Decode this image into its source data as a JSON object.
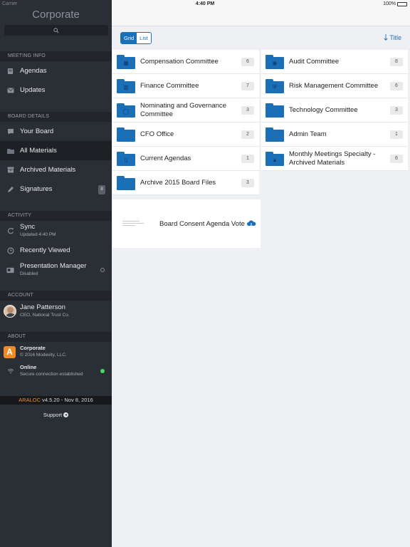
{
  "status_bar": {
    "carrier": "Carrier",
    "time": "4:40 PM",
    "battery": "100%"
  },
  "sidebar": {
    "title": "Corporate",
    "sections": {
      "meeting_info": "MEETING INFO",
      "board_details": "BOARD DETAILS",
      "activity": "ACTIVITY",
      "account": "ACCOUNT",
      "about": "ABOUT"
    },
    "meeting_items": [
      {
        "label": "Agendas",
        "icon": "agenda-icon"
      },
      {
        "label": "Updates",
        "icon": "mail-icon"
      }
    ],
    "board_items": [
      {
        "label": "Your Board",
        "icon": "chat-icon"
      },
      {
        "label": "All Materials",
        "icon": "folder-icon",
        "active": true
      },
      {
        "label": "Archived Materials",
        "icon": "archive-icon"
      },
      {
        "label": "Signatures",
        "icon": "pen-icon",
        "badge": "8"
      }
    ],
    "activity_items": [
      {
        "label": "Sync",
        "sub": "Updated 4:40 PM",
        "icon": "sync-icon"
      },
      {
        "label": "Recently Viewed",
        "icon": "clock-icon"
      },
      {
        "label": "Presentation Manager",
        "sub": "Disabled",
        "icon": "presentation-icon"
      }
    ],
    "account": {
      "name": "Jane Patterson",
      "role": "CEO, National Trust Co."
    },
    "about": [
      {
        "label": "Corporate",
        "sub": "© 2016 Modevity, LLC.",
        "icon": "app-logo-icon"
      },
      {
        "label": "Online",
        "sub": "Secure connection established",
        "icon": "wifi-icon"
      }
    ],
    "version": {
      "brand": "ARALOC",
      "text": " v4.5.20 - Nov 8, 2016"
    },
    "support": "Support"
  },
  "main": {
    "view_toggle": {
      "grid": "Grid",
      "list": "List",
      "selected": "Grid"
    },
    "sort_label": "Title",
    "folders_left": [
      {
        "name": "Compensation Committee",
        "count": "6"
      },
      {
        "name": "Finance Committee",
        "count": "7"
      },
      {
        "name": "Nominating and Governance Committee",
        "count": "3"
      },
      {
        "name": "CFO Office",
        "count": "2"
      },
      {
        "name": "Current Agendas",
        "count": "1"
      },
      {
        "name": "Archive 2015 Board Files",
        "count": "3"
      }
    ],
    "folders_right": [
      {
        "name": "Audit Committee",
        "count": "8"
      },
      {
        "name": "Risk Management Committee",
        "count": "6"
      },
      {
        "name": "Technology Committee",
        "count": "3"
      },
      {
        "name": "Admin Team",
        "count": "1"
      },
      {
        "name": "Monthly Meetings Specialty - Archived Materials",
        "count": "6"
      }
    ],
    "document": {
      "name": "Board Consent Agenda Vote",
      "icon": "cloud-download-icon"
    }
  },
  "colors": {
    "accent": "#1b6fb6",
    "sidebar_bg": "#2a2e35",
    "brand": "#f08a24",
    "online": "#4cd964"
  }
}
